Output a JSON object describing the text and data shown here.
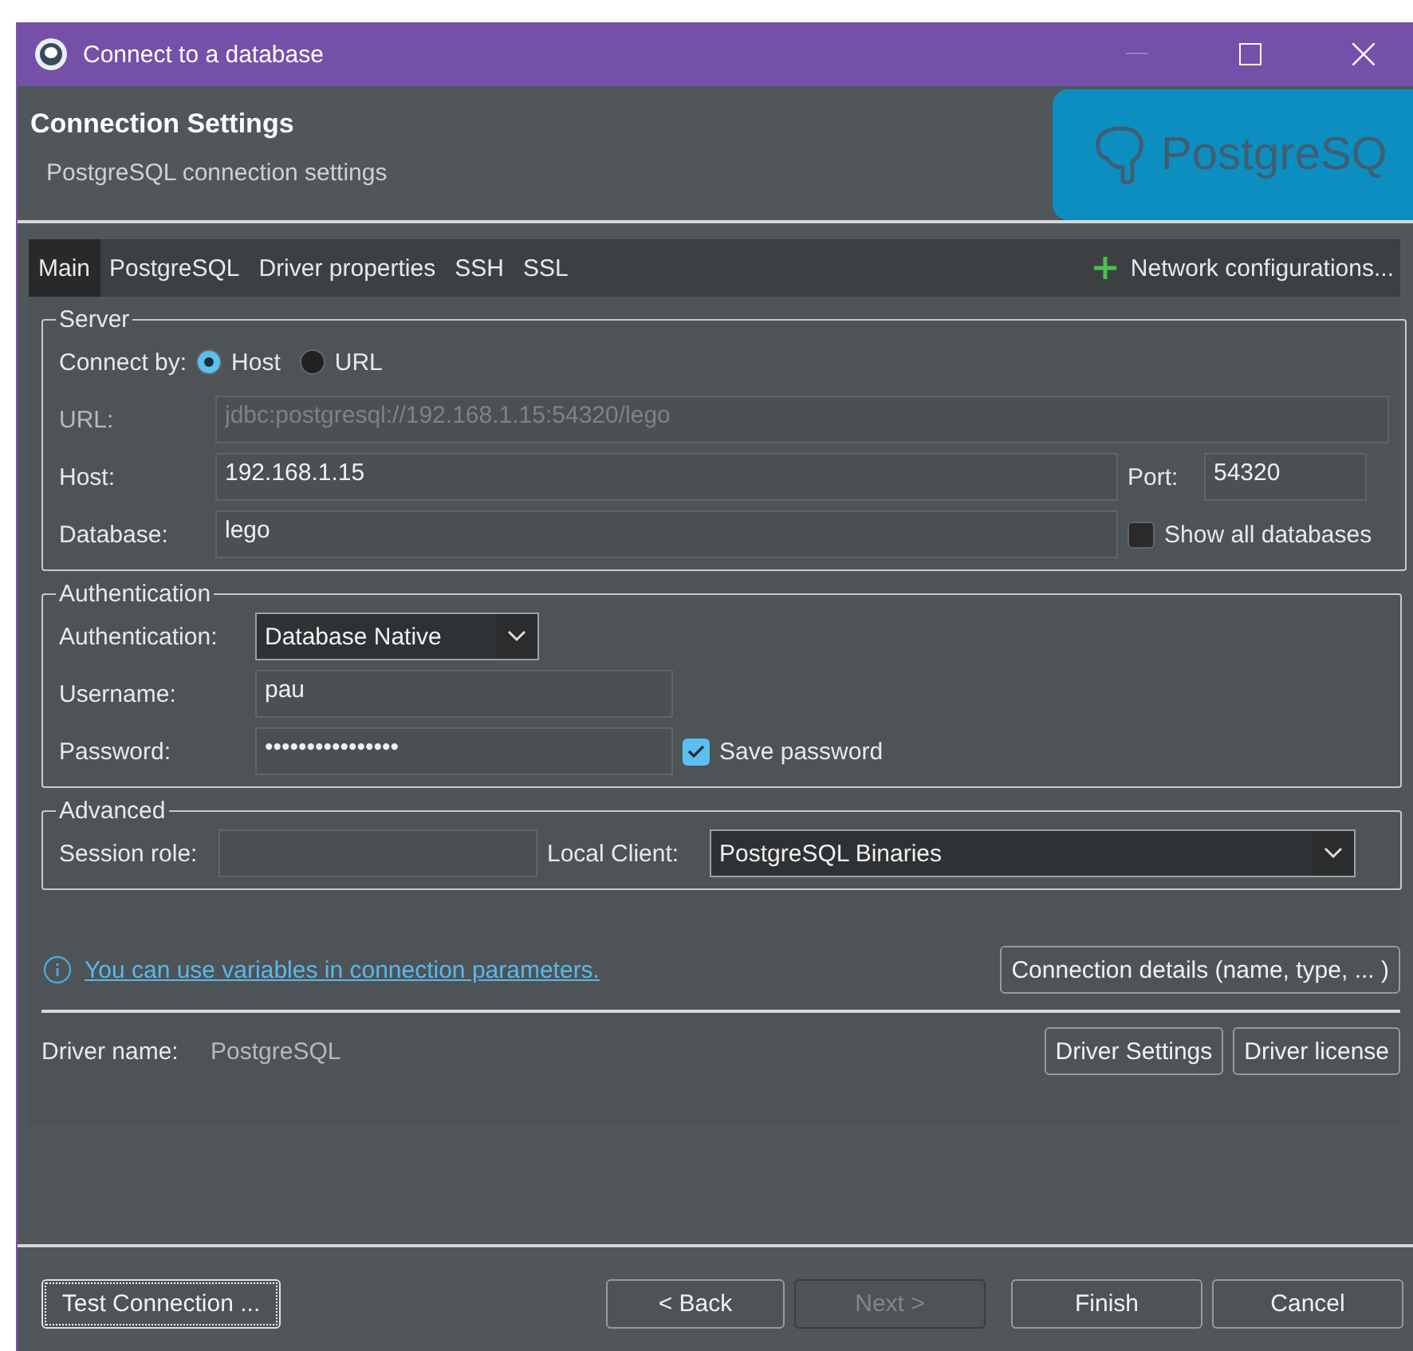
{
  "window": {
    "title": "Connect to a database"
  },
  "header": {
    "title": "Connection Settings",
    "subtitle": "PostgreSQL connection settings",
    "logo_text": "PostgreSQ"
  },
  "tabs": [
    {
      "label": "Main",
      "selected": true
    },
    {
      "label": "PostgreSQL",
      "selected": false
    },
    {
      "label": "Driver properties",
      "selected": false
    },
    {
      "label": "SSH",
      "selected": false
    },
    {
      "label": "SSL",
      "selected": false
    }
  ],
  "network_button": {
    "label": "Network configurations..."
  },
  "server": {
    "legend": "Server",
    "connect_by": {
      "label": "Connect by:",
      "options": [
        {
          "label": "Host",
          "selected": true
        },
        {
          "label": "URL",
          "selected": false
        }
      ]
    },
    "url": {
      "label": "URL:",
      "value": "jdbc:postgresql://192.168.1.15:54320/lego",
      "disabled": true
    },
    "host": {
      "label": "Host:",
      "value": "192.168.1.15"
    },
    "port": {
      "label": "Port:",
      "value": "54320"
    },
    "database": {
      "label": "Database:",
      "value": "lego"
    },
    "show_all_databases": {
      "label": "Show all databases",
      "checked": false
    }
  },
  "authentication": {
    "legend": "Authentication",
    "method": {
      "label": "Authentication:",
      "value": "Database Native"
    },
    "username": {
      "label": "Username:",
      "value": "pau"
    },
    "password": {
      "label": "Password:",
      "value": "••••••••••••••••"
    },
    "save_password": {
      "label": "Save password",
      "checked": true
    }
  },
  "advanced": {
    "legend": "Advanced",
    "session_role": {
      "label": "Session role:"
    },
    "local_client": {
      "label": "Local Client:",
      "value": "PostgreSQL Binaries"
    }
  },
  "info_link": "You can use variables in connection parameters.",
  "details_button": "Connection details (name, type, ... )",
  "driver": {
    "label": "Driver name:",
    "value": "PostgreSQL",
    "buttons": [
      "Driver Settings",
      "Driver license"
    ]
  },
  "footer_buttons": [
    {
      "label": "Test Connection ...",
      "disabled": false,
      "focused": true
    },
    {
      "label": "< Back",
      "disabled": false,
      "focused": false
    },
    {
      "label": "Next >",
      "disabled": true,
      "focused": false
    },
    {
      "label": "Finish",
      "disabled": false,
      "focused": false
    },
    {
      "label": "Cancel",
      "disabled": false,
      "focused": false
    }
  ]
}
